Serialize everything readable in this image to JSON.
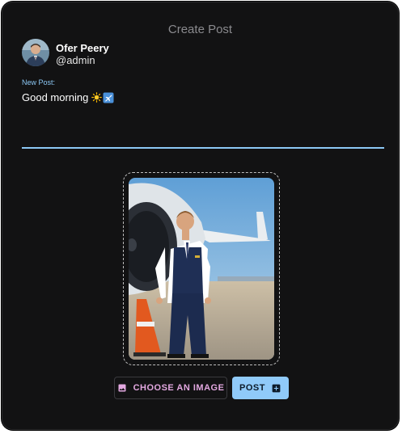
{
  "dialog": {
    "title": "Create Post"
  },
  "user": {
    "name": "Ofer Peery",
    "handle": "@admin",
    "avatar_icon": "user-avatar"
  },
  "post_field": {
    "label": "New Post:",
    "value": "Good morning",
    "emojis": [
      "sun-icon",
      "airplane-icon"
    ]
  },
  "image_preview": {
    "icon": "uploaded-photo"
  },
  "actions": {
    "choose_image_label": "CHOOSE AN IMAGE",
    "choose_image_icon": "image-icon",
    "post_label": "POST",
    "post_icon": "add-box-icon"
  },
  "colors": {
    "background": "#121213",
    "accent_blue": "#90caf9",
    "accent_pink": "#e3a8e0",
    "label_blue": "#8cc8f5"
  }
}
